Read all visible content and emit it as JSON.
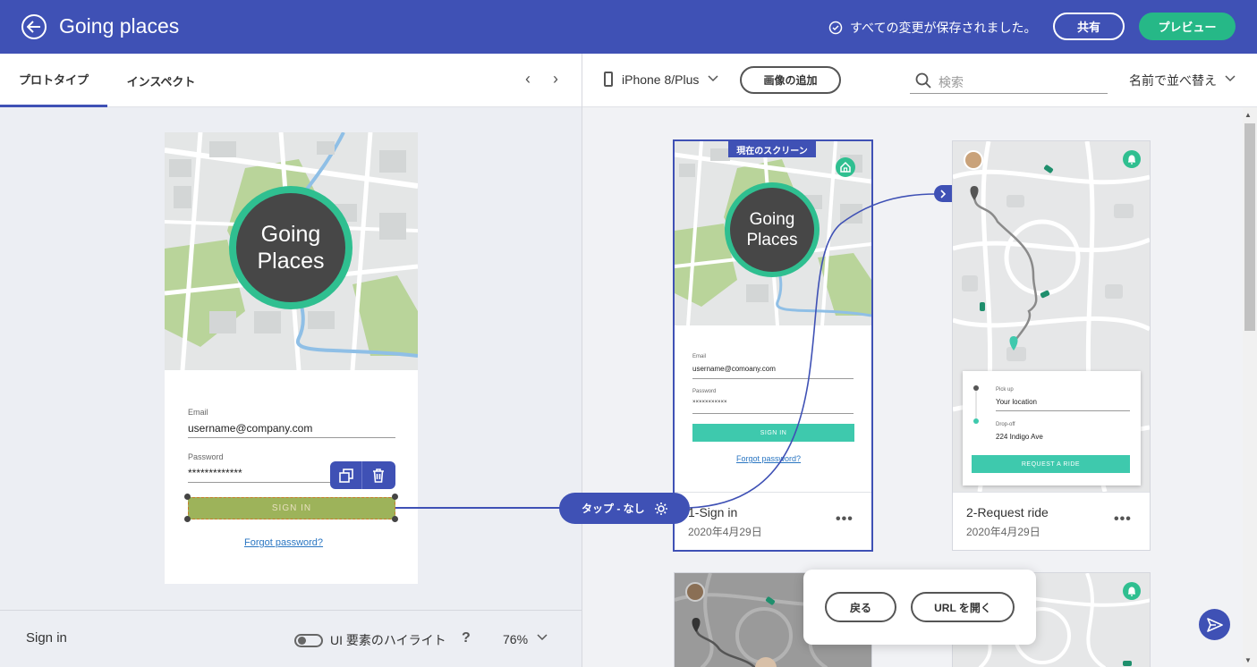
{
  "header": {
    "title": "Going places",
    "saved_status": "すべての変更が保存されました。",
    "share_label": "共有",
    "preview_label": "プレビュー"
  },
  "left_panel": {
    "tabs": [
      {
        "label": "プロトタイプ",
        "active": true
      },
      {
        "label": "インスペクト",
        "active": false
      }
    ],
    "nav_prev": "‹",
    "nav_next": "›",
    "phone": {
      "logo_line1": "Going",
      "logo_line2": "Places",
      "email_label": "Email",
      "email_value": "username@company.com",
      "password_label": "Password",
      "password_value": "*************",
      "signin_label": "SIGN IN",
      "forgot_label": "Forgot password?"
    },
    "bottom": {
      "screen_name": "Sign in",
      "highlight_label": "UI 要素のハイライト",
      "help": "?",
      "zoom": "76%"
    }
  },
  "right_panel": {
    "device": "iPhone 8/Plus",
    "add_image_label": "画像の追加",
    "search_placeholder": "検索",
    "sort_label": "名前で並べ替え",
    "tap_label": "タップ - なし",
    "cards": [
      {
        "title": "1-Sign in",
        "date": "2020年4月29日",
        "current_badge": "現在のスクリーン",
        "logo_line1": "Going",
        "logo_line2": "Places",
        "email_label": "Email",
        "email_value": "username@comoany.com",
        "password_label": "Password",
        "password_value": "×××××××××××",
        "signin_label": "SIGN IN",
        "forgot_label": "Forgot password?"
      },
      {
        "title": "2-Request ride",
        "date": "2020年4月29日",
        "pickup_label": "Pick up",
        "pickup_value": "Your location",
        "dropoff_label": "Drop-off",
        "dropoff_value": "224 Indigo Ave",
        "request_label": "REQUEST A RIDE"
      }
    ],
    "popover": {
      "back_label": "戻る",
      "open_url_label": "URL を開く"
    },
    "more_label": "•••"
  },
  "colors": {
    "header_bg": "#3f51b5",
    "accent_green": "#26b887",
    "signin_selected": "#9db35a",
    "mini_button": "#3ec9ad"
  }
}
